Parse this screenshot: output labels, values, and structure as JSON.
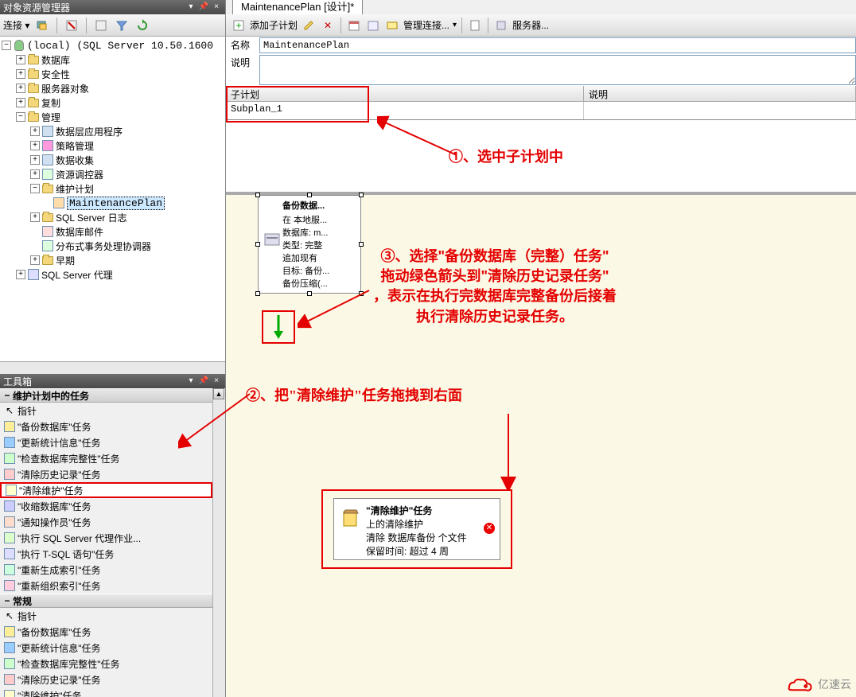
{
  "left_panel": {
    "title": "对象资源管理器",
    "toolbar_connect": "连接 ▾",
    "tree": {
      "root": "(local) (SQL Server 10.50.1600",
      "n_db": "数据库",
      "n_security": "安全性",
      "n_serverobj": "服务器对象",
      "n_replication": "复制",
      "n_mgmt": "管理",
      "n_dac": "数据层应用程序",
      "n_policy": "策略管理",
      "n_datacoll": "数据收集",
      "n_resgov": "资源调控器",
      "n_maintplan": "维护计划",
      "n_mplan_item": "MaintenancePlan",
      "n_sqllog": "SQL Server 日志",
      "n_dbmail": "数据库邮件",
      "n_dtc": "分布式事务处理协调器",
      "n_legacy": "早期",
      "n_agent": "SQL Server 代理"
    }
  },
  "toolbox": {
    "title": "工具箱",
    "group_maint": "维护计划中的任务",
    "pointer": "指针",
    "t_backup": "\"备份数据库\"任务",
    "t_updatestats": "\"更新统计信息\"任务",
    "t_checkint": "\"检查数据库完整性\"任务",
    "t_clearhist": "\"清除历史记录\"任务",
    "t_clearmaint": "\"清除维护\"任务",
    "t_shrink": "\"收缩数据库\"任务",
    "t_notify": "\"通知操作员\"任务",
    "t_execagent": "\"执行 SQL Server 代理作业...",
    "t_exectsql": "\"执行 T-SQL 语句\"任务",
    "t_rebuild": "\"重新生成索引\"任务",
    "t_reorg": "\"重新组织索引\"任务",
    "group_general": "常规",
    "g_pointer": "指针",
    "g_backup": "\"备份数据库\"任务",
    "g_updatestats": "\"更新统计信息\"任务",
    "g_checkint": "\"检查数据库完整性\"任务",
    "g_clearhist": "\"清除历史记录\"任务",
    "g_clearmaint": "\"清除维护\"任务"
  },
  "tab_title": "MaintenancePlan [设计]*",
  "design_toolbar": {
    "add_subplan": "添加子计划",
    "manage_conn": "管理连接...",
    "servers": "服务器..."
  },
  "props": {
    "name_label": "名称",
    "name_value": "MaintenancePlan",
    "desc_label": "说明"
  },
  "table": {
    "col_subplan": "子计划",
    "col_desc": "说明",
    "row1_subplan": "Subplan_1"
  },
  "task_backup": {
    "title": "备份数据...",
    "l1": "在 本地服...",
    "l2": "数据库: m...",
    "l3": "类型: 完整",
    "l4": "追加现有",
    "l5": "目标: 备份...",
    "l6": "备份压缩(..."
  },
  "task_cleanup": {
    "title": "\"清除维护\"任务",
    "l1": "上的清除维护",
    "l2": "清除 数据库备份 个文件",
    "l3": "保留时间: 超过 4 周"
  },
  "annotations": {
    "a1": "①、选中子计划中",
    "a2": "②、把\"清除维护\"任务拖拽到右面",
    "a3_1": "③、选择\"备份数据库（完整）任务\"",
    "a3_2": "拖动绿色箭头到\"清除历史记录任务\"",
    "a3_3": "，表示在执行完数据库完整备份后接着",
    "a3_4": "执行清除历史记录任务。"
  },
  "watermark": "亿速云"
}
